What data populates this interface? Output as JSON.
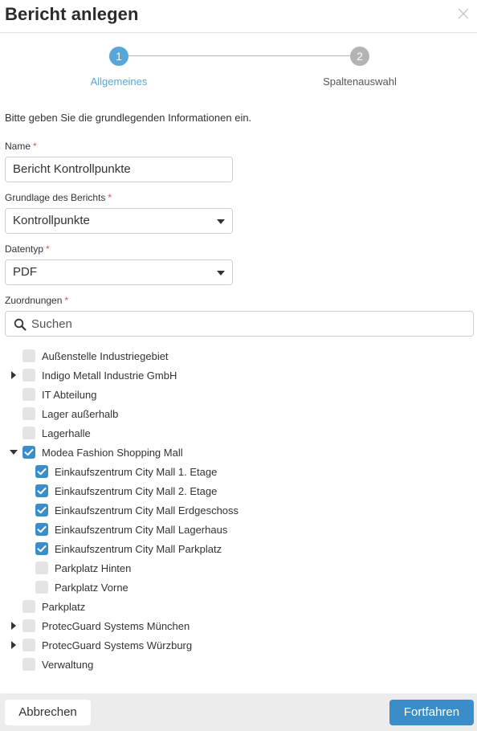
{
  "dialog": {
    "title": "Bericht anlegen",
    "close_icon": "close-icon"
  },
  "stepper": {
    "steps": [
      {
        "number": "1",
        "label": "Allgemeines",
        "active": true
      },
      {
        "number": "2",
        "label": "Spaltenauswahl",
        "active": false
      }
    ],
    "active_color": "#57a6da",
    "inactive_color": "#b3b3b3"
  },
  "form": {
    "intro": "Bitte geben Sie die grundlegenden Informationen ein.",
    "required_marker": "*",
    "name": {
      "label": "Name",
      "value": "Bericht Kontrollpunkte"
    },
    "basis": {
      "label": "Grundlage des Berichts",
      "value": "Kontrollpunkte"
    },
    "datatype": {
      "label": "Datentyp",
      "value": "PDF"
    },
    "assignments": {
      "label": "Zuordnungen",
      "search_placeholder": "Suchen",
      "search_icon": "search-icon"
    }
  },
  "tree": [
    {
      "label": "Außenstelle Industriegebiet",
      "level": 0,
      "checked": false,
      "expander": "none"
    },
    {
      "label": "Indigo Metall Industrie GmbH",
      "level": 0,
      "checked": false,
      "expander": "collapsed"
    },
    {
      "label": "IT Abteilung",
      "level": 0,
      "checked": false,
      "expander": "none"
    },
    {
      "label": "Lager außerhalb",
      "level": 0,
      "checked": false,
      "expander": "none"
    },
    {
      "label": "Lagerhalle",
      "level": 0,
      "checked": false,
      "expander": "none"
    },
    {
      "label": "Modea Fashion Shopping Mall",
      "level": 0,
      "checked": true,
      "expander": "expanded"
    },
    {
      "label": "Einkaufszentrum City Mall 1. Etage",
      "level": 1,
      "checked": true,
      "expander": "none"
    },
    {
      "label": "Einkaufszentrum City Mall 2. Etage",
      "level": 1,
      "checked": true,
      "expander": "none"
    },
    {
      "label": "Einkaufszentrum City Mall Erdgeschoss",
      "level": 1,
      "checked": true,
      "expander": "none"
    },
    {
      "label": "Einkaufszentrum City Mall Lagerhaus",
      "level": 1,
      "checked": true,
      "expander": "none"
    },
    {
      "label": "Einkaufszentrum City Mall Parkplatz",
      "level": 1,
      "checked": true,
      "expander": "none"
    },
    {
      "label": "Parkplatz Hinten",
      "level": 1,
      "checked": false,
      "expander": "none"
    },
    {
      "label": "Parkplatz Vorne",
      "level": 1,
      "checked": false,
      "expander": "none"
    },
    {
      "label": "Parkplatz",
      "level": 0,
      "checked": false,
      "expander": "none"
    },
    {
      "label": "ProtecGuard Systems München",
      "level": 0,
      "checked": false,
      "expander": "collapsed"
    },
    {
      "label": "ProtecGuard Systems Würzburg",
      "level": 0,
      "checked": false,
      "expander": "collapsed"
    },
    {
      "label": "Verwaltung",
      "level": 0,
      "checked": false,
      "expander": "none"
    }
  ],
  "footer": {
    "cancel_label": "Abbrechen",
    "continue_label": "Fortfahren",
    "primary_color": "#3a8dc8"
  }
}
